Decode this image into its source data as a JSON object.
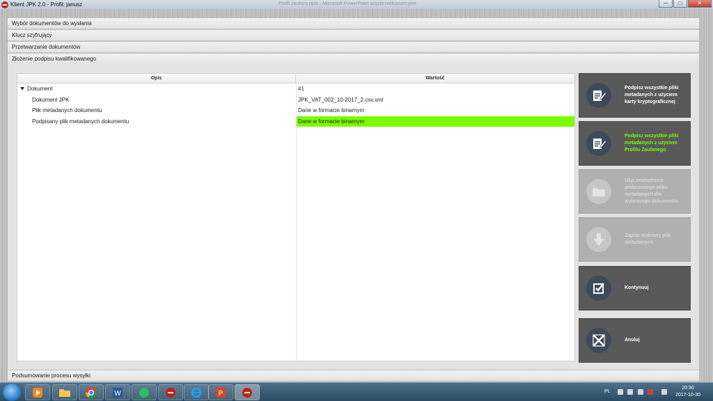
{
  "window": {
    "title": "Klient JPK 2.0 - Profil: janusz",
    "background_window_title": "Profil zaufany.pptx - Microsoft PowerPoint użycie niekomercyjne",
    "minimize": "─",
    "maximize": "□",
    "close": "✕"
  },
  "accordion_top": [
    {
      "label": "Wybór dokumentów do wysłania"
    },
    {
      "label": "Klucz szyfrujący"
    },
    {
      "label": "Przetwarzanie dokumentów"
    },
    {
      "label": "Złożenie podpisu kwalifikowanego"
    }
  ],
  "accordion_bottom": {
    "label": "Podsumowanie procesu wysyłki"
  },
  "grid": {
    "headers": {
      "opis": "Opis",
      "wartosc": "Wartość"
    },
    "rows": [
      {
        "opis": "Dokument",
        "wartosc": "#1",
        "level": 0,
        "expanded": true,
        "highlight": false
      },
      {
        "opis": "Dokument JPK",
        "wartosc": "JPK_VAT_002_10-2017_2.csv.xml",
        "level": 1,
        "highlight": false
      },
      {
        "opis": "Plik metadanych dokumentu",
        "wartosc": "Dane w formacie binarnym",
        "level": 1,
        "highlight": false
      },
      {
        "opis": "Podpisany plik metadanych dokumentu",
        "wartosc": "Dane w formacie binarnym",
        "level": 1,
        "highlight": true
      }
    ],
    "highlight_color": "#7cfc00"
  },
  "actions": [
    {
      "label": "Podpisz wszystkie pliki metadanych z użyciem karty kryptograficznej",
      "icon": "sign-document-icon",
      "enabled": true,
      "label_color": "#ffffff"
    },
    {
      "label": "Podpisz wszystkie pliki metadanych z użyciem Profilu Zaufanego",
      "icon": "sign-document-icon",
      "enabled": true,
      "label_color": "#7cfc00"
    },
    {
      "label": "Użyj zewnętrznie podpisanego pliku metadanych dla wybranego dokumentu",
      "icon": "folder-icon",
      "enabled": false
    },
    {
      "label": "Zapisz wybrany plik metadanych",
      "icon": "download-arrow-icon",
      "enabled": false
    },
    {
      "label": "Kontynuuj",
      "icon": "checkbox-icon",
      "enabled": true
    },
    {
      "label": "Anuluj",
      "icon": "cancel-icon",
      "enabled": true
    }
  ],
  "taskbar": {
    "apps": [
      "media-player-icon",
      "file-explorer-icon",
      "chrome-icon",
      "word-icon",
      "evernote-icon",
      "jpk-client-icon",
      "internet-explorer-icon",
      "powerpoint-icon",
      "jpk-client-active-icon"
    ],
    "language": "PL",
    "time": "20:30",
    "date": "2017-10-30"
  }
}
